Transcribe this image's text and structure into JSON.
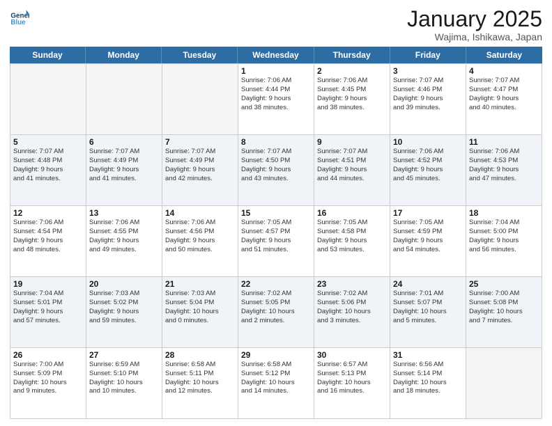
{
  "header": {
    "logo_general": "General",
    "logo_blue": "Blue",
    "title": "January 2025",
    "subtitle": "Wajima, Ishikawa, Japan"
  },
  "weekdays": [
    "Sunday",
    "Monday",
    "Tuesday",
    "Wednesday",
    "Thursday",
    "Friday",
    "Saturday"
  ],
  "weeks": [
    [
      {
        "day": "",
        "info": "",
        "empty": true
      },
      {
        "day": "",
        "info": "",
        "empty": true
      },
      {
        "day": "",
        "info": "",
        "empty": true
      },
      {
        "day": "1",
        "info": "Sunrise: 7:06 AM\nSunset: 4:44 PM\nDaylight: 9 hours\nand 38 minutes."
      },
      {
        "day": "2",
        "info": "Sunrise: 7:06 AM\nSunset: 4:45 PM\nDaylight: 9 hours\nand 38 minutes."
      },
      {
        "day": "3",
        "info": "Sunrise: 7:07 AM\nSunset: 4:46 PM\nDaylight: 9 hours\nand 39 minutes."
      },
      {
        "day": "4",
        "info": "Sunrise: 7:07 AM\nSunset: 4:47 PM\nDaylight: 9 hours\nand 40 minutes."
      }
    ],
    [
      {
        "day": "5",
        "info": "Sunrise: 7:07 AM\nSunset: 4:48 PM\nDaylight: 9 hours\nand 41 minutes."
      },
      {
        "day": "6",
        "info": "Sunrise: 7:07 AM\nSunset: 4:49 PM\nDaylight: 9 hours\nand 41 minutes."
      },
      {
        "day": "7",
        "info": "Sunrise: 7:07 AM\nSunset: 4:49 PM\nDaylight: 9 hours\nand 42 minutes."
      },
      {
        "day": "8",
        "info": "Sunrise: 7:07 AM\nSunset: 4:50 PM\nDaylight: 9 hours\nand 43 minutes."
      },
      {
        "day": "9",
        "info": "Sunrise: 7:07 AM\nSunset: 4:51 PM\nDaylight: 9 hours\nand 44 minutes."
      },
      {
        "day": "10",
        "info": "Sunrise: 7:06 AM\nSunset: 4:52 PM\nDaylight: 9 hours\nand 45 minutes."
      },
      {
        "day": "11",
        "info": "Sunrise: 7:06 AM\nSunset: 4:53 PM\nDaylight: 9 hours\nand 47 minutes."
      }
    ],
    [
      {
        "day": "12",
        "info": "Sunrise: 7:06 AM\nSunset: 4:54 PM\nDaylight: 9 hours\nand 48 minutes."
      },
      {
        "day": "13",
        "info": "Sunrise: 7:06 AM\nSunset: 4:55 PM\nDaylight: 9 hours\nand 49 minutes."
      },
      {
        "day": "14",
        "info": "Sunrise: 7:06 AM\nSunset: 4:56 PM\nDaylight: 9 hours\nand 50 minutes."
      },
      {
        "day": "15",
        "info": "Sunrise: 7:05 AM\nSunset: 4:57 PM\nDaylight: 9 hours\nand 51 minutes."
      },
      {
        "day": "16",
        "info": "Sunrise: 7:05 AM\nSunset: 4:58 PM\nDaylight: 9 hours\nand 53 minutes."
      },
      {
        "day": "17",
        "info": "Sunrise: 7:05 AM\nSunset: 4:59 PM\nDaylight: 9 hours\nand 54 minutes."
      },
      {
        "day": "18",
        "info": "Sunrise: 7:04 AM\nSunset: 5:00 PM\nDaylight: 9 hours\nand 56 minutes."
      }
    ],
    [
      {
        "day": "19",
        "info": "Sunrise: 7:04 AM\nSunset: 5:01 PM\nDaylight: 9 hours\nand 57 minutes."
      },
      {
        "day": "20",
        "info": "Sunrise: 7:03 AM\nSunset: 5:02 PM\nDaylight: 9 hours\nand 59 minutes."
      },
      {
        "day": "21",
        "info": "Sunrise: 7:03 AM\nSunset: 5:04 PM\nDaylight: 10 hours\nand 0 minutes."
      },
      {
        "day": "22",
        "info": "Sunrise: 7:02 AM\nSunset: 5:05 PM\nDaylight: 10 hours\nand 2 minutes."
      },
      {
        "day": "23",
        "info": "Sunrise: 7:02 AM\nSunset: 5:06 PM\nDaylight: 10 hours\nand 3 minutes."
      },
      {
        "day": "24",
        "info": "Sunrise: 7:01 AM\nSunset: 5:07 PM\nDaylight: 10 hours\nand 5 minutes."
      },
      {
        "day": "25",
        "info": "Sunrise: 7:00 AM\nSunset: 5:08 PM\nDaylight: 10 hours\nand 7 minutes."
      }
    ],
    [
      {
        "day": "26",
        "info": "Sunrise: 7:00 AM\nSunset: 5:09 PM\nDaylight: 10 hours\nand 9 minutes."
      },
      {
        "day": "27",
        "info": "Sunrise: 6:59 AM\nSunset: 5:10 PM\nDaylight: 10 hours\nand 10 minutes."
      },
      {
        "day": "28",
        "info": "Sunrise: 6:58 AM\nSunset: 5:11 PM\nDaylight: 10 hours\nand 12 minutes."
      },
      {
        "day": "29",
        "info": "Sunrise: 6:58 AM\nSunset: 5:12 PM\nDaylight: 10 hours\nand 14 minutes."
      },
      {
        "day": "30",
        "info": "Sunrise: 6:57 AM\nSunset: 5:13 PM\nDaylight: 10 hours\nand 16 minutes."
      },
      {
        "day": "31",
        "info": "Sunrise: 6:56 AM\nSunset: 5:14 PM\nDaylight: 10 hours\nand 18 minutes."
      },
      {
        "day": "",
        "info": "",
        "empty": true
      }
    ]
  ]
}
